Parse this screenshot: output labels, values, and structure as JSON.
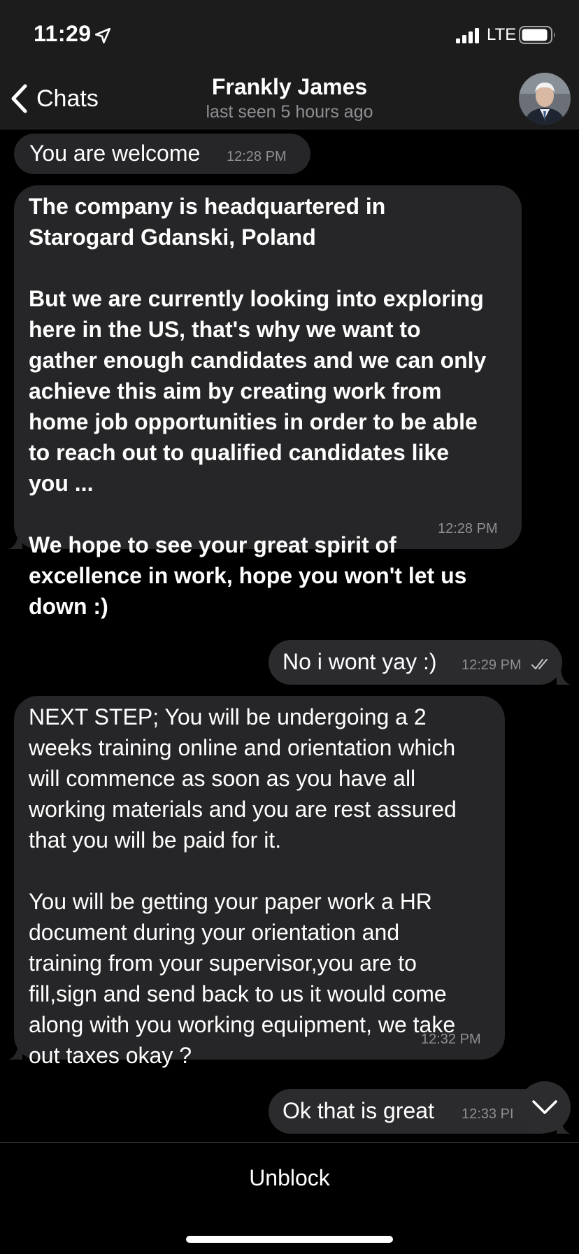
{
  "status_bar": {
    "time": "11:29",
    "network": "LTE",
    "icons": [
      "location-arrow-icon",
      "signal-icon",
      "battery-icon"
    ]
  },
  "header": {
    "back_label": "Chats",
    "contact_name": "Frankly James",
    "last_seen": "last seen 5 hours ago"
  },
  "messages": [
    {
      "direction": "incoming",
      "text": "You are welcome",
      "time": "12:28 PM"
    },
    {
      "direction": "incoming",
      "text": "The company is headquartered in\nStarogard Gdanski, Poland\n\nBut we are currently looking into exploring\nhere in the US, that's why we want to\ngather enough candidates and we can only\nachieve this aim by creating work from\nhome job opportunities in order to be able\nto reach out to qualified candidates like\nyou ...\n\nWe hope to see your great spirit of\nexcellence in work, hope you won't let us\ndown :)",
      "time": "12:28 PM"
    },
    {
      "direction": "outgoing",
      "text": "No i wont yay :)",
      "time": "12:29 PM",
      "read": true
    },
    {
      "direction": "incoming",
      "text": "NEXT STEP; You will be undergoing a 2\nweeks training online and orientation which\nwill commence as soon as you have all\nworking materials and you are rest assured\nthat you will be paid for it.\n\nYou will be getting your paper work a HR\ndocument during your orientation and\ntraining from your supervisor,you are to\nfill,sign and send back to us it would come\nalong with you working equipment, we take\nout taxes okay ?",
      "time": "12:32 PM"
    },
    {
      "direction": "outgoing",
      "text": "Ok that is great",
      "time": "12:33 PI"
    }
  ],
  "bottom_bar": {
    "unblock_label": "Unblock"
  },
  "colors": {
    "background": "#000000",
    "bar_background": "#1c1c1d",
    "incoming_bubble": "#262628",
    "outgoing_bubble": "#2b2b2e",
    "secondary_text": "#8e8e93"
  }
}
